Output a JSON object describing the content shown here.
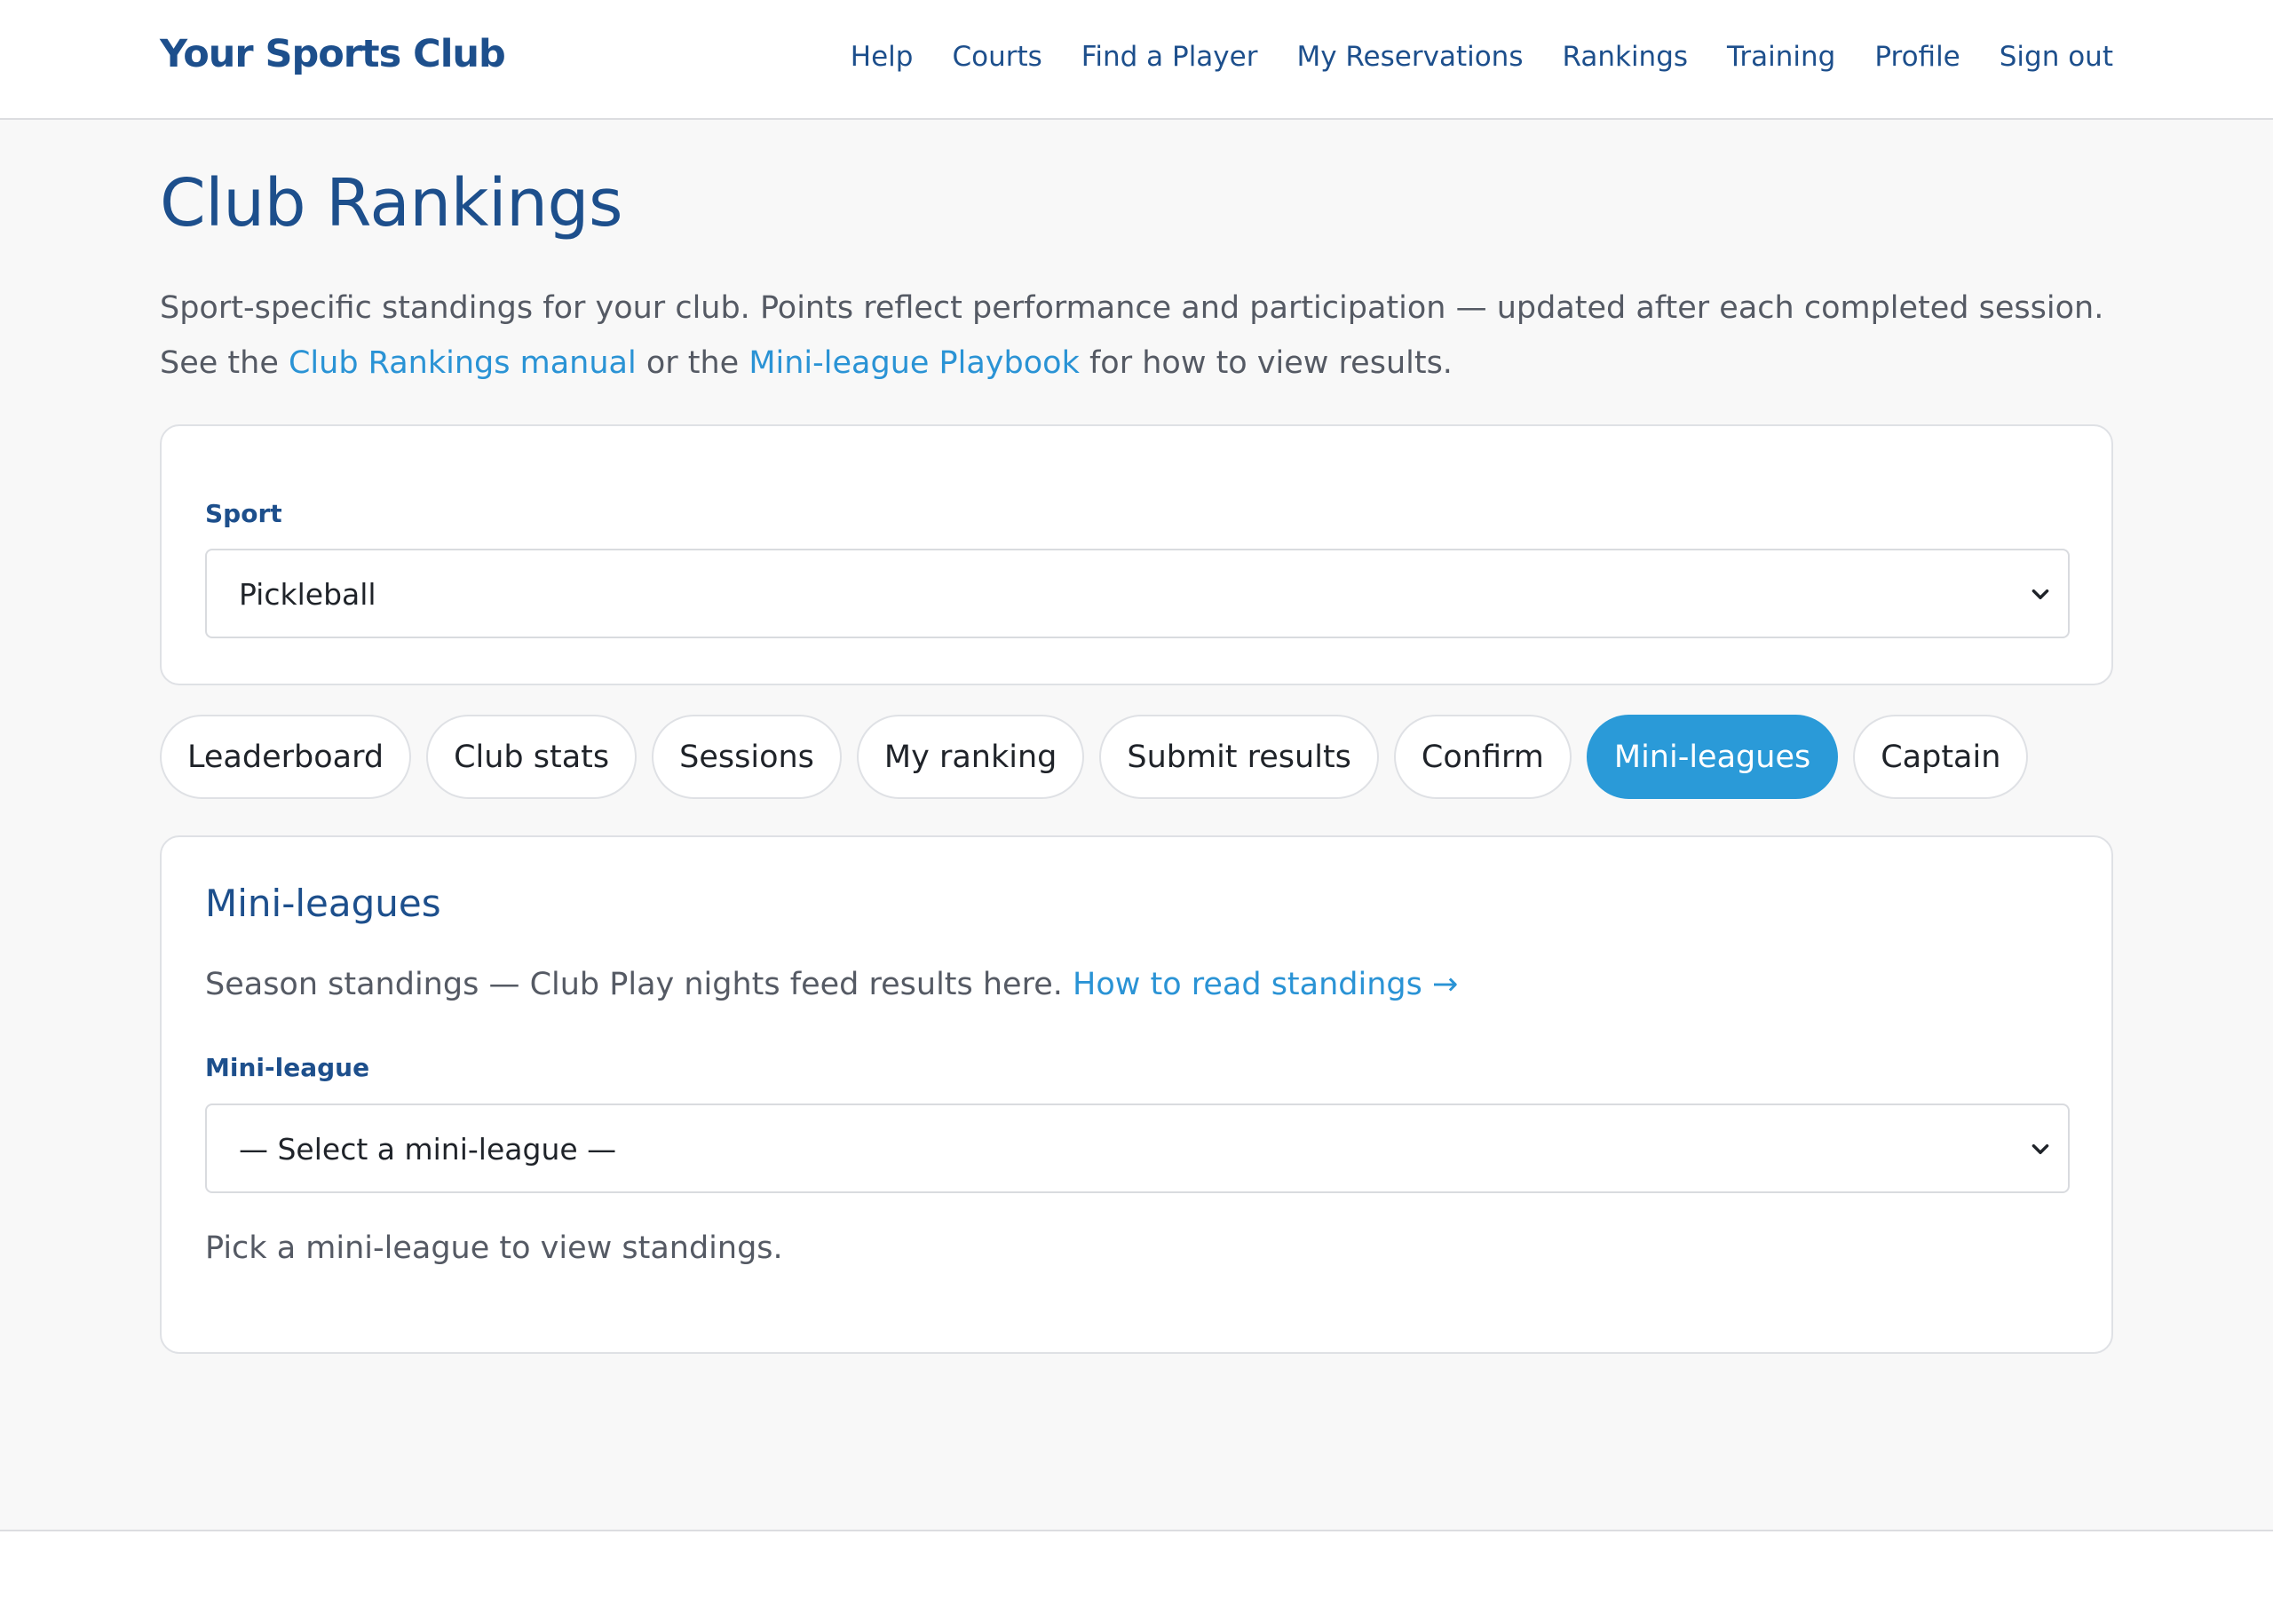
{
  "header": {
    "brand": "Your Sports Club",
    "nav": [
      "Help",
      "Courts",
      "Find a Player",
      "My Reservations",
      "Rankings",
      "Training",
      "Profile",
      "Sign out"
    ]
  },
  "main": {
    "title": "Club Rankings",
    "intro": {
      "text_before": "Sport-specific standings for your club. Points reflect performance and participation — updated after each completed session. See the ",
      "link1": "Club Rankings manual",
      "text_middle": " or the ",
      "link2": "Mini-league Playbook",
      "text_after": " for how to view results."
    },
    "sport": {
      "label": "Sport",
      "selected": "Pickleball"
    },
    "tabs": [
      "Leaderboard",
      "Club stats",
      "Sessions",
      "My ranking",
      "Submit results",
      "Confirm",
      "Mini-leagues",
      "Captain"
    ],
    "active_tab": "Mini-leagues",
    "mini_leagues": {
      "title": "Mini-leagues",
      "description": "Season standings — Club Play nights feed results here. ",
      "help_link": "How to read standings →",
      "select_label": "Mini-league",
      "select_placeholder": "— Select a mini-league —",
      "empty_hint": "Pick a mini-league to view standings."
    }
  },
  "colors": {
    "brand": "#1d4f8c",
    "link": "#2a93d5",
    "active_tab": "#2a9ad8",
    "background": "#f8f8f8"
  },
  "icons": {
    "select_arrow": "chevron-down-icon"
  }
}
